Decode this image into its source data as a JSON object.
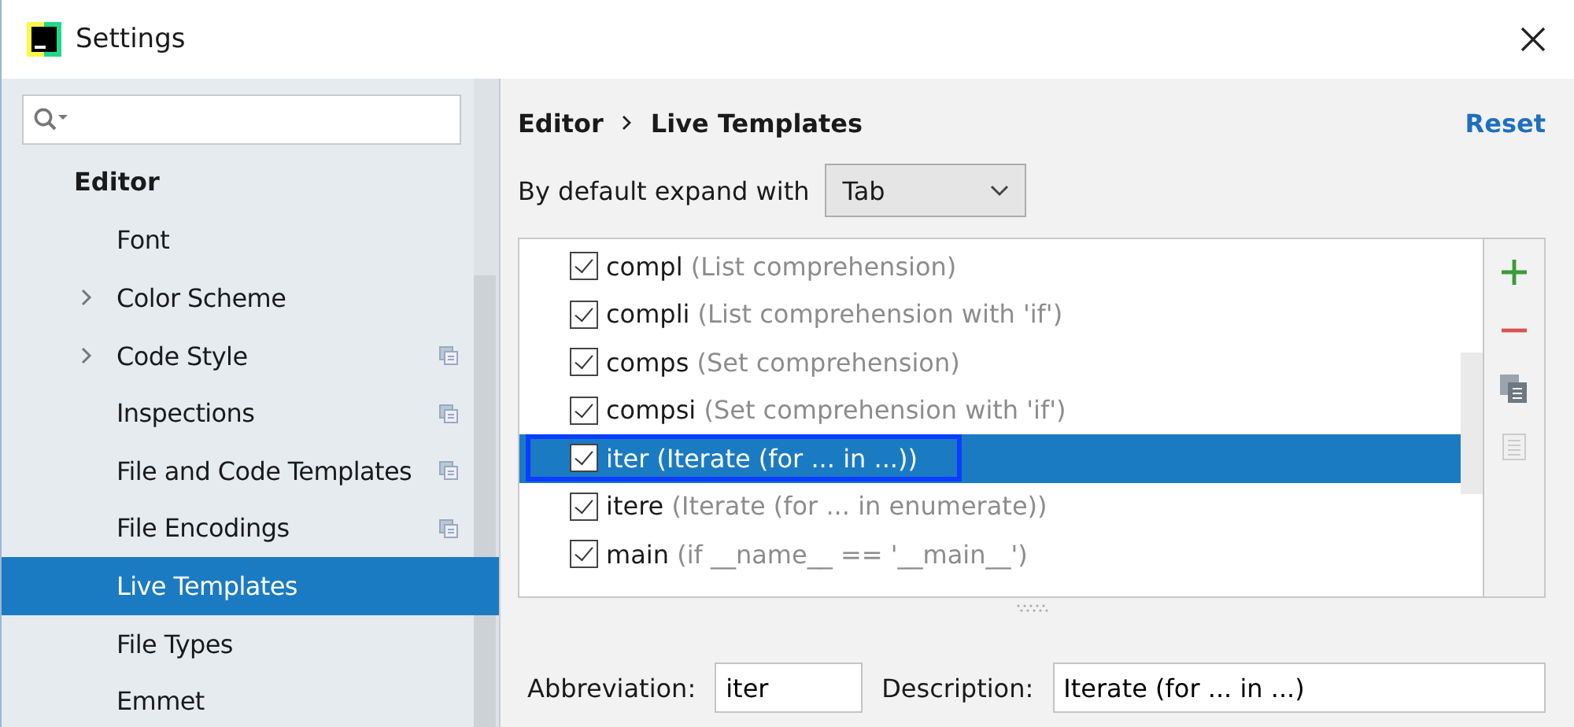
{
  "window": {
    "title": "Settings"
  },
  "sidebar": {
    "items": [
      {
        "label": "Editor",
        "kind": "header",
        "expandable": false,
        "project_icon": false,
        "selected": false
      },
      {
        "label": "Font",
        "kind": "item",
        "expandable": false,
        "project_icon": false,
        "selected": false
      },
      {
        "label": "Color Scheme",
        "kind": "item",
        "expandable": true,
        "project_icon": false,
        "selected": false
      },
      {
        "label": "Code Style",
        "kind": "item",
        "expandable": true,
        "project_icon": true,
        "selected": false
      },
      {
        "label": "Inspections",
        "kind": "item",
        "expandable": false,
        "project_icon": true,
        "selected": false
      },
      {
        "label": "File and Code Templates",
        "kind": "item",
        "expandable": false,
        "project_icon": true,
        "selected": false
      },
      {
        "label": "File Encodings",
        "kind": "item",
        "expandable": false,
        "project_icon": true,
        "selected": false
      },
      {
        "label": "Live Templates",
        "kind": "item",
        "expandable": false,
        "project_icon": false,
        "selected": true
      },
      {
        "label": "File Types",
        "kind": "item",
        "expandable": false,
        "project_icon": false,
        "selected": false
      },
      {
        "label": "Emmet",
        "kind": "item",
        "expandable": false,
        "project_icon": false,
        "selected": false
      }
    ]
  },
  "breadcrumb": [
    "Editor",
    "Live Templates"
  ],
  "reset_link": "Reset",
  "expand_with": {
    "label": "By default expand with",
    "value": "Tab"
  },
  "templates": [
    {
      "abbreviation": "compl",
      "description": "(List comprehension)",
      "checked": true,
      "selected": false
    },
    {
      "abbreviation": "compli",
      "description": "(List comprehension with 'if')",
      "checked": true,
      "selected": false
    },
    {
      "abbreviation": "comps",
      "description": "(Set comprehension)",
      "checked": true,
      "selected": false
    },
    {
      "abbreviation": "compsi",
      "description": "(Set comprehension with 'if')",
      "checked": true,
      "selected": false
    },
    {
      "abbreviation": "iter",
      "description": "(Iterate (for ... in ...))",
      "checked": true,
      "selected": true
    },
    {
      "abbreviation": "itere",
      "description": "(Iterate (for ... in enumerate))",
      "checked": true,
      "selected": false
    },
    {
      "abbreviation": "main",
      "description": "(if __name__ == '__main__')",
      "checked": true,
      "selected": false
    }
  ],
  "toolbar": [
    {
      "kind": "add",
      "disabled": false
    },
    {
      "kind": "remove",
      "disabled": false
    },
    {
      "kind": "copy",
      "disabled": false
    },
    {
      "kind": "edit",
      "disabled": true
    }
  ],
  "details": {
    "abbreviation_label": "Abbreviation:",
    "abbreviation": "iter",
    "description_label": "Description:",
    "description": "Iterate (for ... in ...)"
  }
}
